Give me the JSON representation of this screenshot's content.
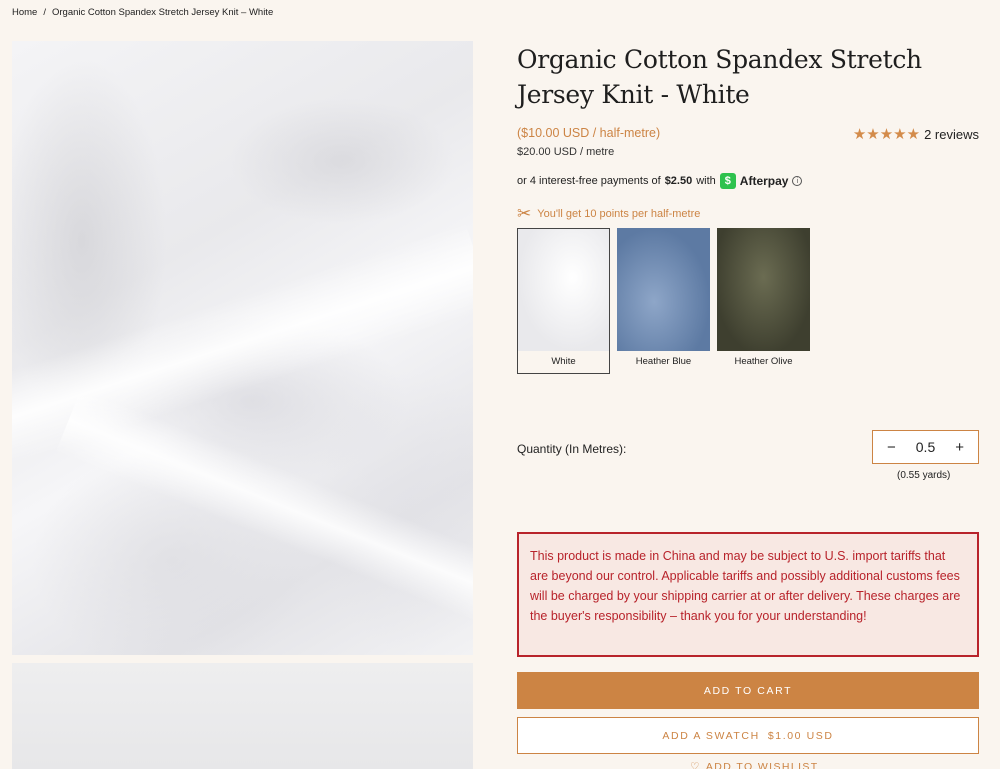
{
  "breadcrumb": {
    "home": "Home",
    "separator": "/",
    "current": "Organic Cotton Spandex Stretch Jersey Knit – White"
  },
  "product": {
    "title": "Organic Cotton Spandex Stretch Jersey Knit - White",
    "price_half_metre": "($10.00 USD / half-metre)",
    "price_metre": "$20.00 USD / metre",
    "rating": {
      "stars": "★★★★★",
      "reviews_text": "2 reviews"
    },
    "afterpay": {
      "prefix": "or 4 interest-free payments of",
      "amount": "$2.50",
      "with": "with",
      "logo_glyph": "$",
      "brand": "Afterpay",
      "info_glyph": "i"
    },
    "points": {
      "icon": "scissors-icon",
      "glyph": "✂",
      "text": "You'll get 10 points per half-metre"
    },
    "swatches": [
      {
        "name": "White",
        "selected": true
      },
      {
        "name": "Heather Blue",
        "selected": false
      },
      {
        "name": "Heather Olive",
        "selected": false
      }
    ],
    "quantity": {
      "label": "Quantity (In Metres):",
      "minus": "−",
      "value": "0.5",
      "plus": "+",
      "yards": "(0.55 yards)"
    },
    "tariff_notice": "This product is made in China and may be subject to U.S. import tariffs that are beyond our control. Applicable tariffs and possibly additional customs fees will be charged by your shipping carrier at or after delivery. These charges are the buyer's responsibility – thank you for your understanding!",
    "buttons": {
      "add_to_cart": "ADD TO CART",
      "add_swatch": "ADD A SWATCH",
      "swatch_price": "$1.00 USD",
      "wishlist_glyph": "♡",
      "wishlist": "ADD TO WISHLIST"
    }
  },
  "colors": {
    "accent": "#cc8444",
    "background": "#faf5ef",
    "notice_red": "#b8232b",
    "afterpay_green": "#2ec24e"
  }
}
